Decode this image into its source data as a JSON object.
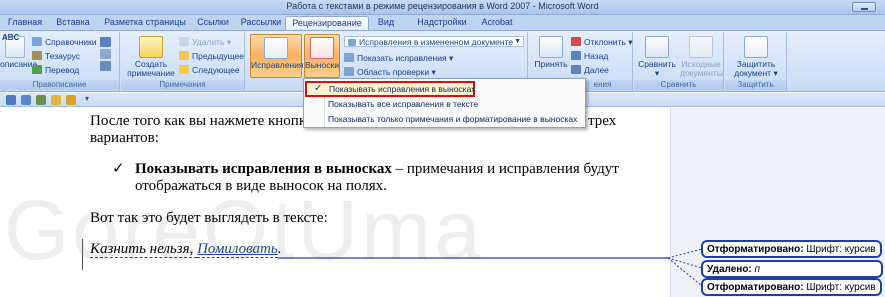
{
  "window": {
    "title": "Работа с текстами в режиме рецензирования в Word 2007 - Microsoft Word"
  },
  "tabs": [
    {
      "label": "Главная",
      "active": false
    },
    {
      "label": "Вставка",
      "active": false
    },
    {
      "label": "Разметка страницы",
      "active": false
    },
    {
      "label": "Ссылки",
      "active": false
    },
    {
      "label": "Рассылки",
      "active": false
    },
    {
      "label": "Рецензирование",
      "active": true
    },
    {
      "label": "Вид",
      "active": false
    },
    {
      "label": "Надстройки",
      "active": false
    },
    {
      "label": "Acrobat",
      "active": false
    }
  ],
  "ribbon": {
    "proofing": {
      "label": "Правописание",
      "spelling_partial": "описание",
      "research": "Справочники",
      "thesaurus": "Тезаурус",
      "translate": "Перевод",
      "abc_badge": "ABC"
    },
    "comments": {
      "label": "Примечания",
      "create": "Создать примечание",
      "delete": "Удалить",
      "previous": "Предыдущее",
      "next": "Следующее"
    },
    "tracking": {
      "track_changes": "Исправления",
      "balloons": "Выноски",
      "display_combo": "Исправления в измененном документе",
      "show_markup": "Показать исправления",
      "review_pane": "Область проверки"
    },
    "changes": {
      "label": "Изменения",
      "label_visible": "ения",
      "accept": "Принять",
      "reject": "Отклонить",
      "back": "Назад",
      "forward": "Далее"
    },
    "compare": {
      "label": "Сравнить",
      "compare": "Сравнить",
      "source": "Исходные документы"
    },
    "protect": {
      "label": "Защитить",
      "protect": "Защитить документ"
    }
  },
  "dropdown": {
    "items": [
      {
        "label": "Показывать исправления в выносках",
        "checked": true
      },
      {
        "label": "Показывать все исправления в тексте",
        "checked": false
      },
      {
        "label": "Показывать только примечания и форматирование в выносках",
        "checked": false
      }
    ]
  },
  "document": {
    "line1_a": "После того как вы нажмете кнопку",
    "line1_b": "трех",
    "line2": "вариантов:",
    "bullet_mark": "✓",
    "bullet_bold": "Показывать исправления в выносках",
    "bullet_rest": " – примечания и исправления будут",
    "bullet_line2": "отображаться в виде выносок на полях.",
    "para2": "Вот так это будет выглядеть в тексте:",
    "example_a": "Казнить нельзя, ",
    "example_b": "Помиловать",
    "example_c": "."
  },
  "balloons": [
    {
      "label": "Отформатировано:",
      "value": "Шрифт: курсив"
    },
    {
      "label": "Удалено:",
      "value": "п"
    },
    {
      "label": "Отформатировано:",
      "value": "Шрифт: курсив"
    }
  ],
  "watermark": "GoreOtUma"
}
